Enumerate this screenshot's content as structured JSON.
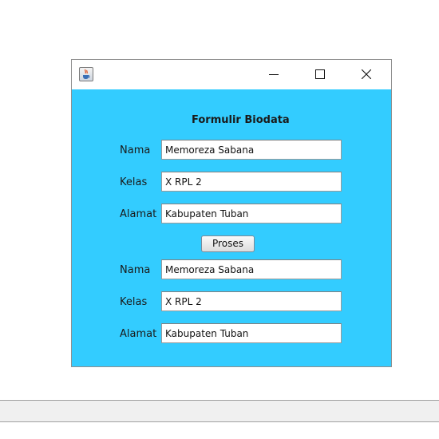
{
  "window": {
    "title": "",
    "controls": {
      "minimize": "minimize-icon",
      "maximize": "maximize-icon",
      "close": "close-icon"
    },
    "app_icon": "java-cup-icon"
  },
  "form": {
    "title": "Formulir Biodata",
    "inputs": {
      "nama_label": "Nama",
      "nama_value": "Memoreza Sabana",
      "kelas_label": "Kelas",
      "kelas_value": "X RPL 2",
      "alamat_label": "Alamat",
      "alamat_value": "Kabupaten Tuban"
    },
    "submit_label": "Proses",
    "outputs": {
      "nama_label": "Nama",
      "nama_value": "Memoreza Sabana",
      "kelas_label": "Kelas",
      "kelas_value": "X RPL 2",
      "alamat_label": "Alamat",
      "alamat_value": "Kabupaten Tuban"
    }
  },
  "colors": {
    "content_background": "#33ccff",
    "titlebar_background": "#ffffff",
    "field_background": "#ffffff"
  }
}
